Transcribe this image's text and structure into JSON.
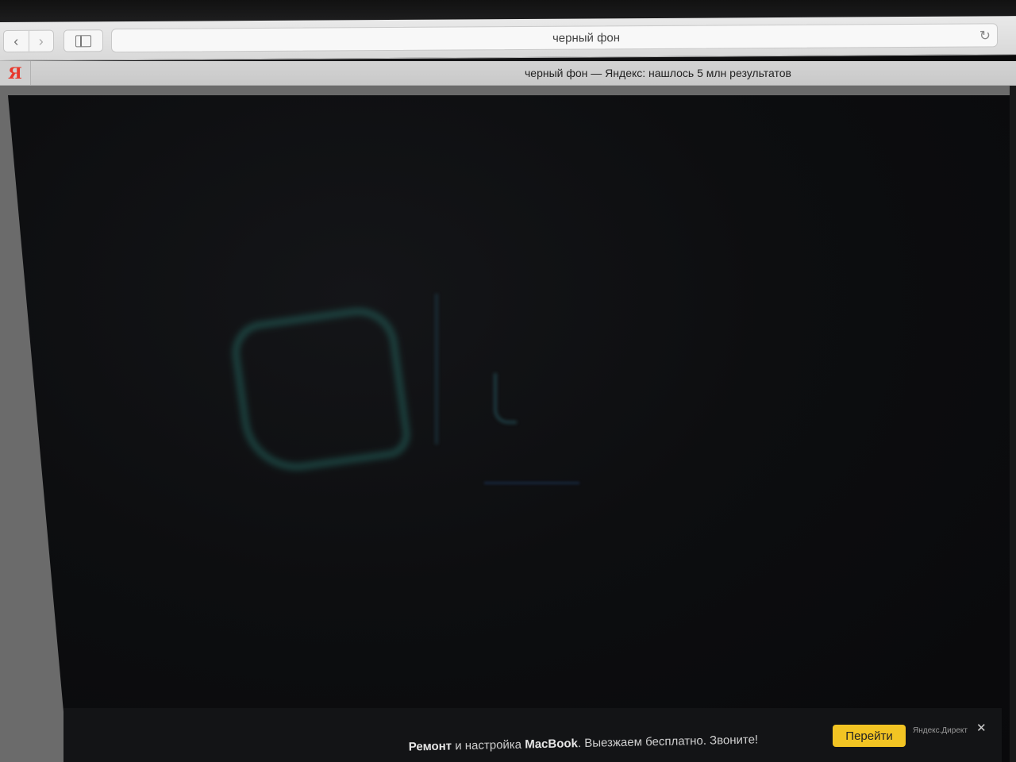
{
  "browser": {
    "address_bar": "черный фон",
    "tab_title": "черный фон — Яндекс: нашлось 5 млн результатов",
    "yandex_logo": "Я",
    "icons": {
      "back": "chevron-left-icon",
      "forward": "chevron-right-icon",
      "sidebar": "sidebar-icon",
      "reload": "reload-icon"
    }
  },
  "ad": {
    "text_start": "Ремонт",
    "text_mid": " и настройка ",
    "text_brand": "MacBook",
    "text_end": ". Выезжаем бесплатно. Звоните!",
    "button_label": "Перейти",
    "source": "Яндекс.Директ",
    "close_glyph": "✕",
    "button_color": "#f2c423"
  },
  "colors": {
    "page_background": "#0b0b0c",
    "yandex_red": "#e8372b"
  }
}
